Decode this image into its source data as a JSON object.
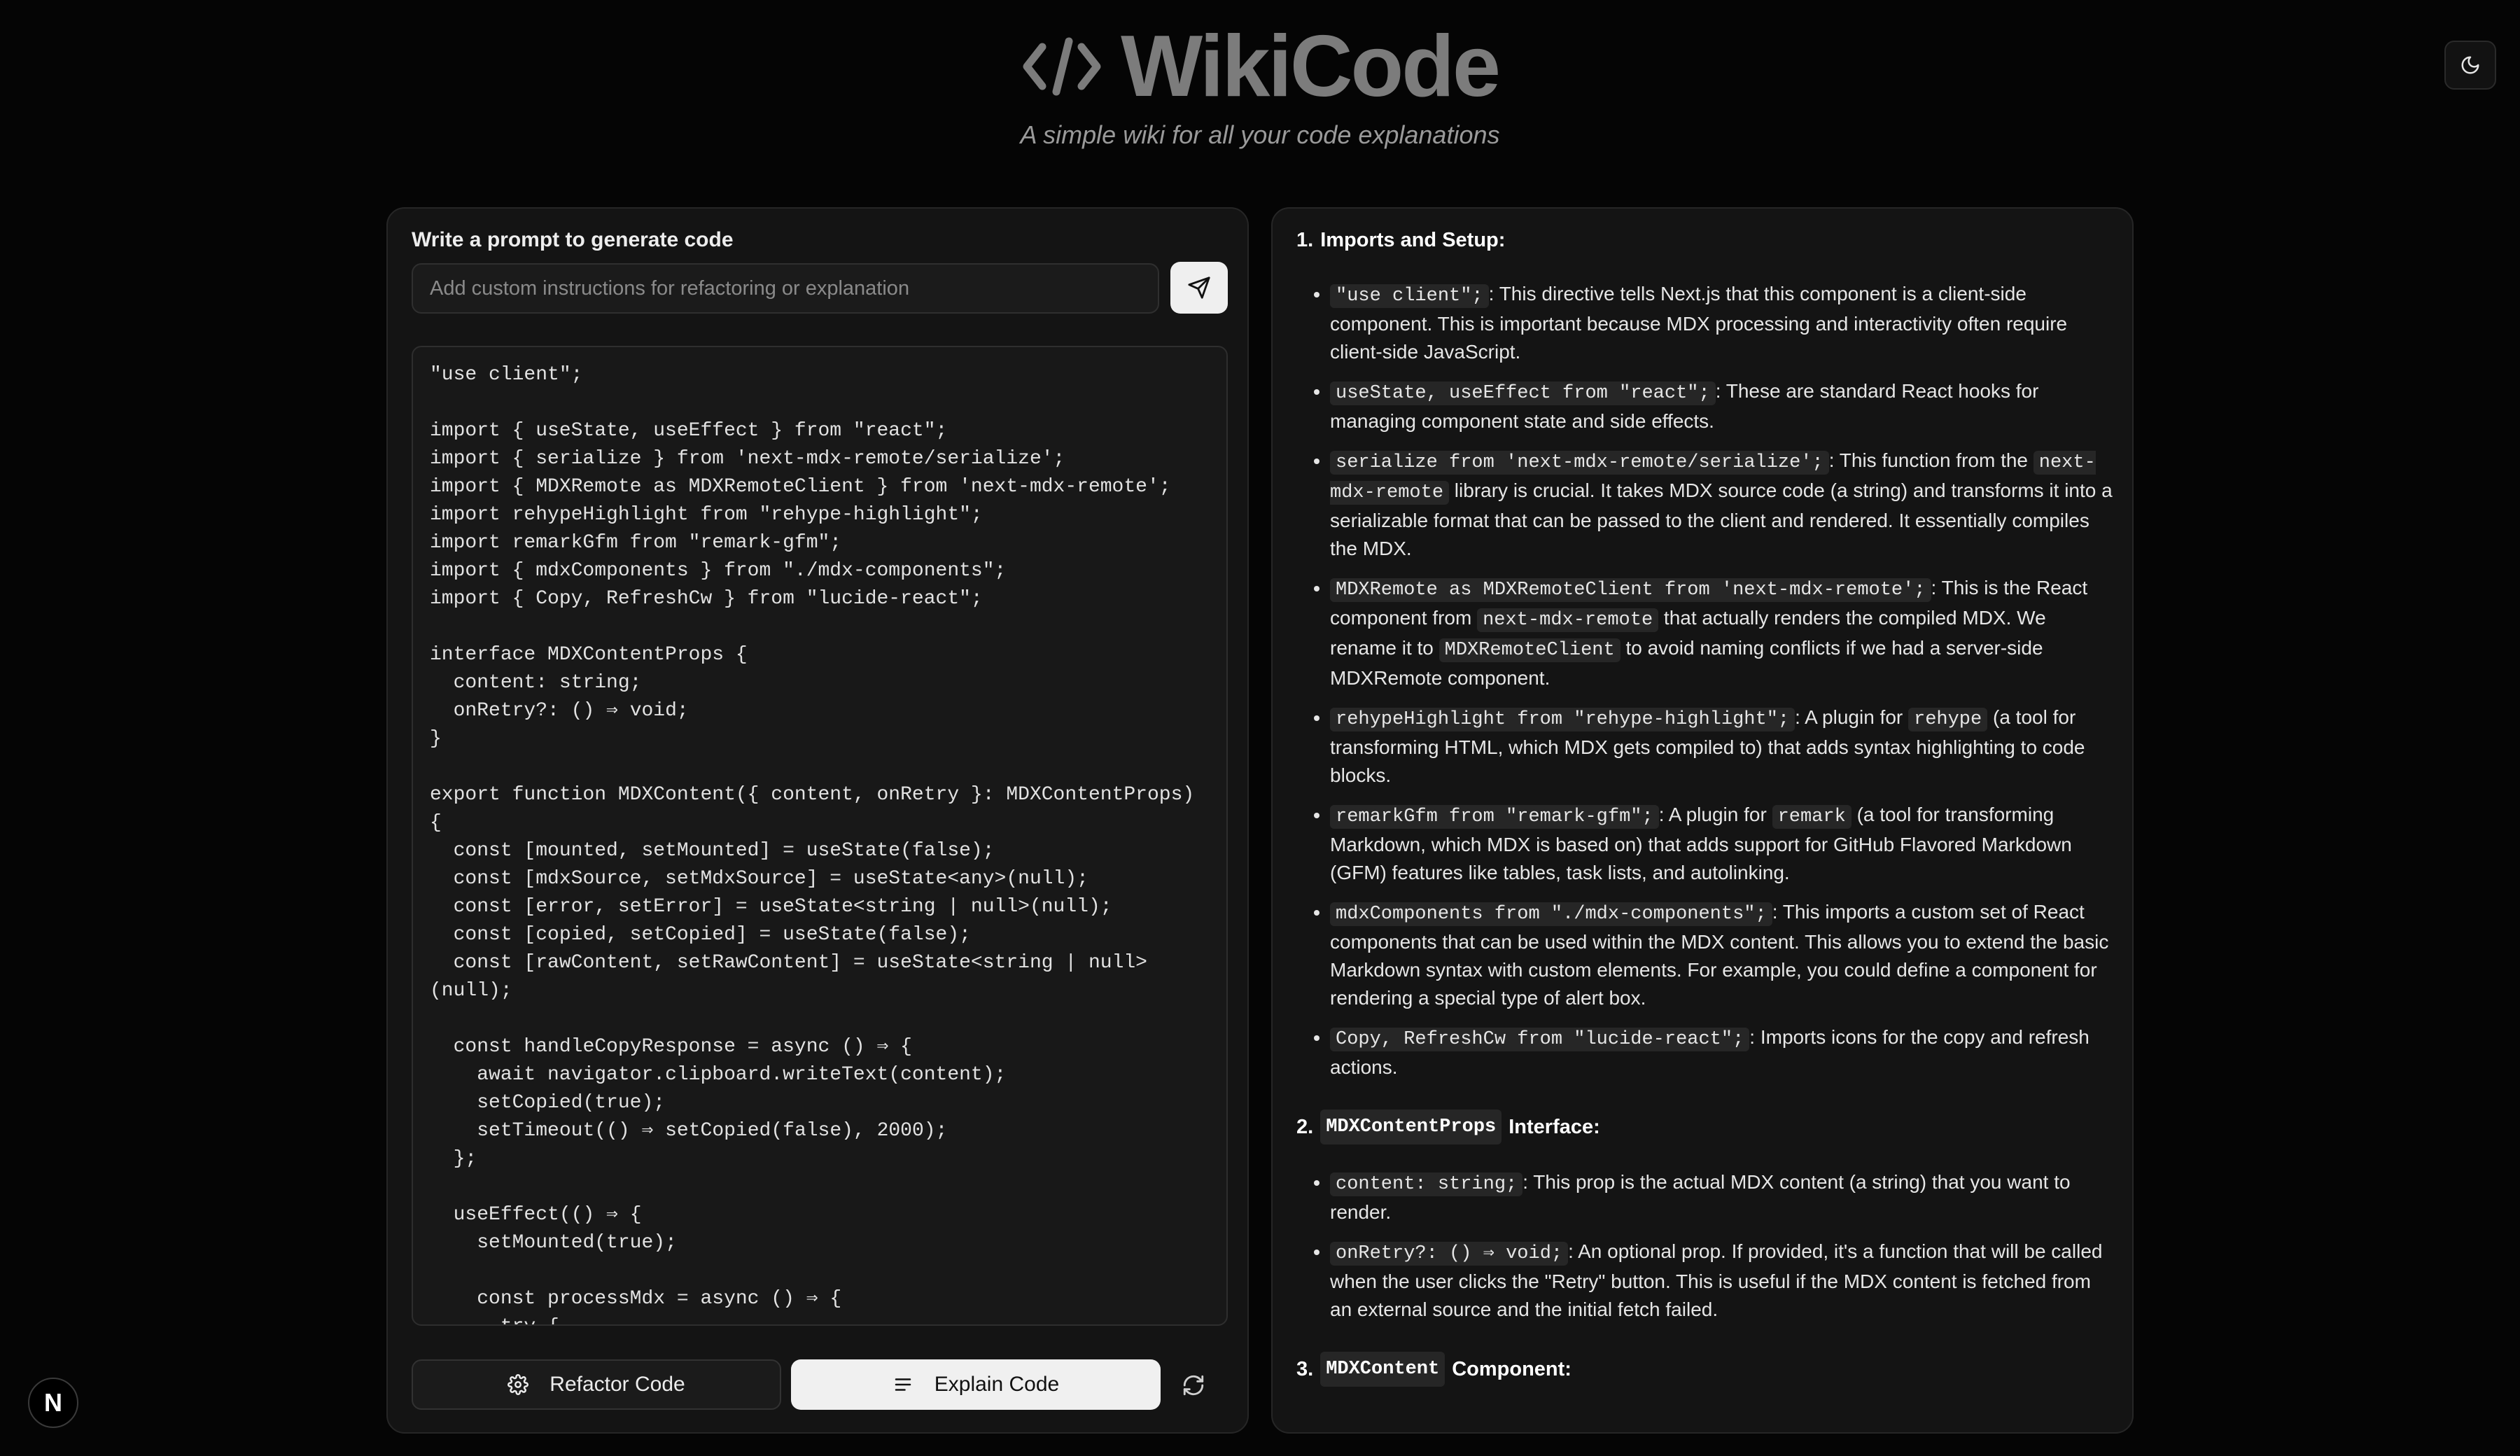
{
  "app": {
    "title": "WikiCode",
    "subtitle": "A simple wiki for all your code explanations"
  },
  "prompt": {
    "label": "Write a prompt to generate code",
    "placeholder": "Add custom instructions for refactoring or explanation",
    "value": ""
  },
  "code": {
    "content": "\"use client\";\n\nimport { useState, useEffect } from \"react\";\nimport { serialize } from 'next-mdx-remote/serialize';\nimport { MDXRemote as MDXRemoteClient } from 'next-mdx-remote';\nimport rehypeHighlight from \"rehype-highlight\";\nimport remarkGfm from \"remark-gfm\";\nimport { mdxComponents } from \"./mdx-components\";\nimport { Copy, RefreshCw } from \"lucide-react\";\n\ninterface MDXContentProps {\n  content: string;\n  onRetry?: () ⇒ void;\n}\n\nexport function MDXContent({ content, onRetry }: MDXContentProps)\n{\n  const [mounted, setMounted] = useState(false);\n  const [mdxSource, setMdxSource] = useState<any>(null);\n  const [error, setError] = useState<string | null>(null);\n  const [copied, setCopied] = useState(false);\n  const [rawContent, setRawContent] = useState<string | null>\n(null);\n\n  const handleCopyResponse = async () ⇒ {\n    await navigator.clipboard.writeText(content);\n    setCopied(true);\n    setTimeout(() ⇒ setCopied(false), 2000);\n  };\n\n  useEffect(() ⇒ {\n    setMounted(true);\n\n    const processMdx = async () ⇒ {\n      try {"
  },
  "buttons": {
    "refactor": "Refactor Code",
    "explain": "Explain Code"
  },
  "explanation": {
    "sections": [
      {
        "number": "1.",
        "code": "",
        "title": "Imports and Setup:",
        "items": [
          {
            "code": "\"use client\";",
            "text": ": This directive tells Next.js that this component is a client-side component. This is important because MDX processing and interactivity often require client-side JavaScript."
          },
          {
            "code": "useState, useEffect from \"react\";",
            "text": ": These are standard React hooks for managing component state and side effects."
          },
          {
            "code": "serialize from 'next-mdx-remote/serialize';",
            "text_a": ": This function from the ",
            "code_b": "next-mdx-remote",
            "text": " library is crucial. It takes MDX source code (a string) and transforms it into a serializable format that can be passed to the client and rendered. It essentially compiles the MDX."
          },
          {
            "code": "MDXRemote as MDXRemoteClient from 'next-mdx-remote';",
            "text_a": ": This is the React component from ",
            "code_b": "next-mdx-remote",
            "text_c": " that actually renders the compiled MDX. We rename it to ",
            "code_d": "MDXRemoteClient",
            "text": " to avoid naming conflicts if we had a server-side MDXRemote component."
          },
          {
            "code": "rehypeHighlight from \"rehype-highlight\";",
            "text_a": ": A plugin for ",
            "code_b": "rehype",
            "text": " (a tool for transforming HTML, which MDX gets compiled to) that adds syntax highlighting to code blocks."
          },
          {
            "code": "remarkGfm from \"remark-gfm\";",
            "text_a": ": A plugin for ",
            "code_b": "remark",
            "text": " (a tool for transforming Markdown, which MDX is based on) that adds support for GitHub Flavored Markdown (GFM) features like tables, task lists, and autolinking."
          },
          {
            "code": "mdxComponents from \"./mdx-components\";",
            "text": ": This imports a custom set of React components that can be used within the MDX content. This allows you to extend the basic Markdown syntax with custom elements. For example, you could define a component for rendering a special type of alert box."
          },
          {
            "code": "Copy, RefreshCw from \"lucide-react\";",
            "text": ": Imports icons for the copy and refresh actions."
          }
        ]
      },
      {
        "number": "2.",
        "code": "MDXContentProps",
        "title": "Interface:",
        "items": [
          {
            "code": "content: string;",
            "text": ": This prop is the actual MDX content (a string) that you want to render."
          },
          {
            "code": "onRetry?: () ⇒ void;",
            "text": ": An optional prop. If provided, it's a function that will be called when the user clicks the \"Retry\" button. This is useful if the MDX content is fetched from an external source and the initial fetch failed."
          }
        ]
      },
      {
        "number": "3.",
        "code": "MDXContent",
        "title": "Component:",
        "items": []
      }
    ]
  },
  "badge": {
    "letter": "N"
  },
  "colors": {
    "background": "#050505",
    "panel": "#141414",
    "accent_button": "#f0f0f0",
    "title_gray": "#7c7c7c"
  }
}
